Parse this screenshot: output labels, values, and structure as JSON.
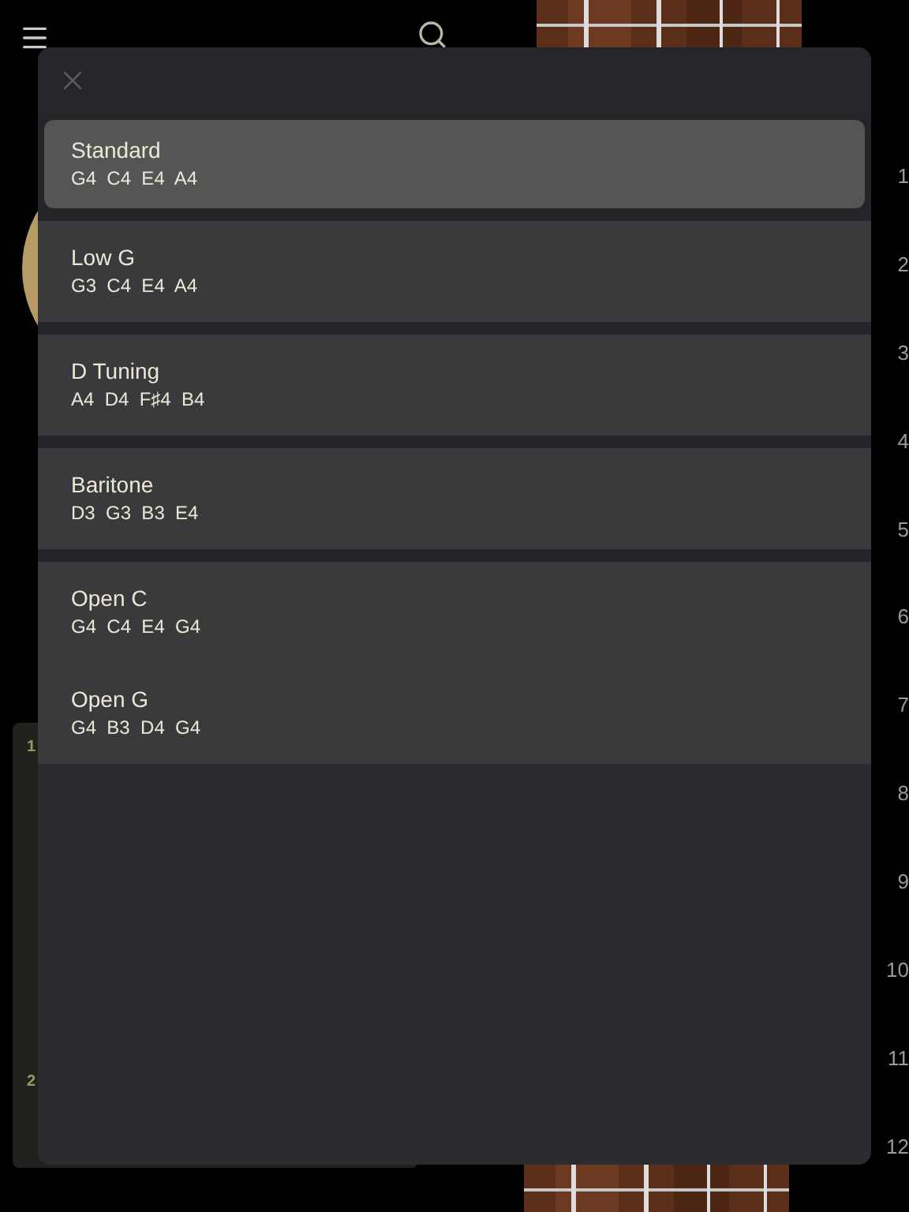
{
  "fret_numbers": [
    "1",
    "2",
    "3",
    "4",
    "5",
    "6",
    "7",
    "8",
    "9",
    "10",
    "11",
    "12"
  ],
  "side_panel": {
    "labels": [
      "1",
      "2"
    ]
  },
  "tuning_dialog": {
    "tunings": [
      {
        "name": "Standard",
        "notes": "G4  C4  E4  A4",
        "selected": true,
        "divided": false
      },
      {
        "name": "Low G",
        "notes": "G3  C4  E4  A4",
        "selected": false,
        "divided": true
      },
      {
        "name": "D Tuning",
        "notes": "A4  D4  F♯4  B4",
        "selected": false,
        "divided": true
      },
      {
        "name": "Baritone",
        "notes": "D3  G3  B3  E4",
        "selected": false,
        "divided": true
      },
      {
        "name": "Open C",
        "notes": "G4  C4  E4  G4",
        "selected": false,
        "divided": true
      },
      {
        "name": "Open G",
        "notes": "G4  B3  D4  G4",
        "selected": false,
        "divided": false
      }
    ]
  }
}
